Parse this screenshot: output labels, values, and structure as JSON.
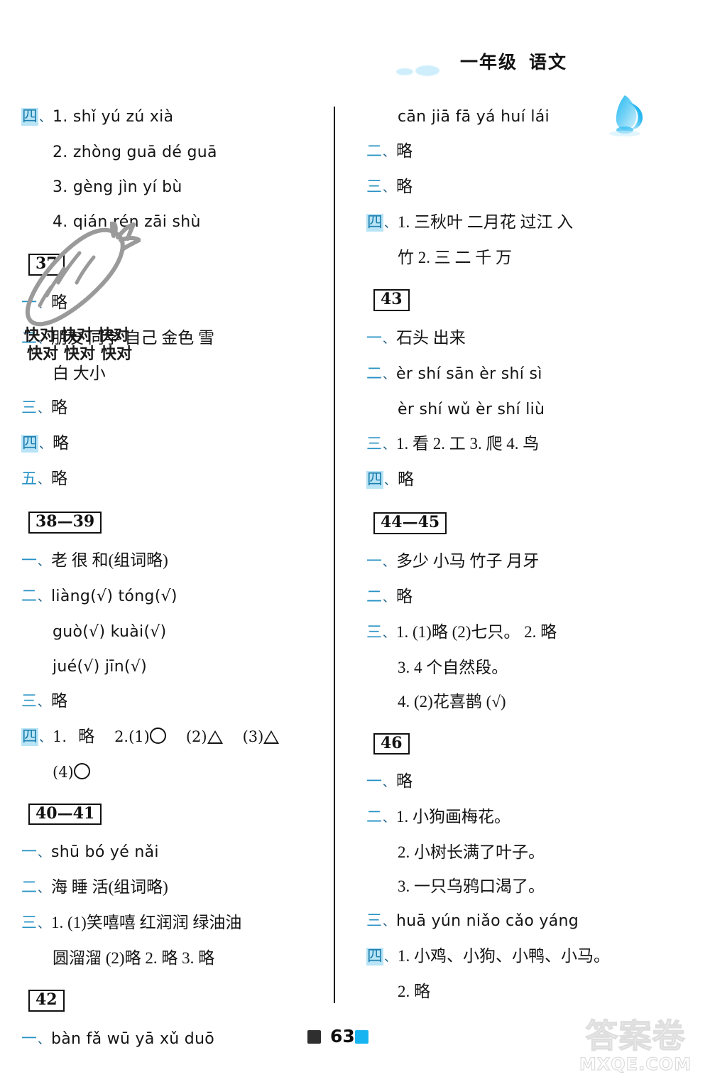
{
  "header": {
    "title_grade": "一年级",
    "title_subject": "语文",
    "cloud_icon": "cloud-icon",
    "bunny_icon": "blue-bunny-icon",
    "accent_color": "#16b4f0"
  },
  "footer": {
    "page_number": "63",
    "left_square_color": "#2f2f2f",
    "right_square_color": "#16b4f0"
  },
  "watermark": {
    "brand_cn": "答案卷",
    "site_url": "MXQE.COM",
    "overlay_text": "快对",
    "overlay_tiles": [
      "快对",
      "快对",
      "快对",
      "快对",
      "快对",
      "快对"
    ]
  },
  "decorations": {
    "carrot_icon": "carrot-outline-icon"
  },
  "left_column": {
    "continued_section": {
      "marker": "四",
      "dun": "、",
      "lines": [
        "1. shǐ   yú   zú   xià",
        "2. zhòng   guā   dé   guā",
        "3. gèng   jìn   yí   bù",
        "4. qián   rén   zāi   shù"
      ]
    },
    "sections": [
      {
        "box_label": "37",
        "items": [
          {
            "marker": "一",
            "dun": "、",
            "text": "略"
          },
          {
            "marker": "二",
            "dun": "、",
            "text": "朋友   同学   自己   金色   雪",
            "cont": "白   大小"
          },
          {
            "marker": "三",
            "dun": "、",
            "text": "略"
          },
          {
            "marker": "四",
            "dun": "、",
            "text": "略"
          },
          {
            "marker": "五",
            "dun": "、",
            "text": "略"
          }
        ]
      },
      {
        "box_label": "38—39",
        "items": [
          {
            "marker": "一",
            "dun": "、",
            "text": "老   很   和(组词略)"
          },
          {
            "marker": "二",
            "dun": "、",
            "text": "liàng(√)   tóng(√)",
            "cont1": "guò(√)   kuài(√)",
            "cont2": "jué(√)   jīn(√)"
          },
          {
            "marker": "三",
            "dun": "、",
            "text": "略"
          },
          {
            "marker": "四",
            "dun": "、",
            "text": "1. 略   2. (1)○   (2)△   (3)△",
            "cont": "(4)○"
          }
        ]
      },
      {
        "box_label": "40—41",
        "items": [
          {
            "marker": "一",
            "dun": "、",
            "text": "shū   bó   yé   nǎi"
          },
          {
            "marker": "二",
            "dun": "、",
            "text": "海   睡   活(组词略)"
          },
          {
            "marker": "三",
            "dun": "、",
            "text": "1. (1)笑嘻嘻   红润润   绿油油",
            "cont": "圆溜溜   (2)略   2. 略   3. 略"
          }
        ]
      },
      {
        "box_label": "42",
        "items": [
          {
            "marker": "一",
            "dun": "、",
            "text": "bàn fǎ   wū yā   xǔ duō"
          }
        ]
      }
    ]
  },
  "right_column": {
    "continued_section": {
      "line": "cān jiā   fā yá   huí lái",
      "items": [
        {
          "marker": "二",
          "dun": "、",
          "text": "略"
        },
        {
          "marker": "三",
          "dun": "、",
          "text": "略"
        },
        {
          "marker": "四",
          "dun": "、",
          "text": "1. 三秋叶   二月花   过江   入",
          "cont": "竹   2. 三   二   千   万"
        }
      ]
    },
    "sections": [
      {
        "box_label": "43",
        "items": [
          {
            "marker": "一",
            "dun": "、",
            "text": "石头   出来"
          },
          {
            "marker": "二",
            "dun": "、",
            "text": "èr shí   sān èr   shí sì",
            "cont": "èr shí   wǔ èr   shí liù"
          },
          {
            "marker": "三",
            "dun": "、",
            "text": "1. 看   2. 工   3. 爬   4. 鸟"
          },
          {
            "marker": "四",
            "dun": "、",
            "text": "略"
          }
        ]
      },
      {
        "box_label": "44—45",
        "items": [
          {
            "marker": "一",
            "dun": "、",
            "text": "多少   小马   竹子   月牙"
          },
          {
            "marker": "二",
            "dun": "、",
            "text": "略"
          },
          {
            "marker": "三",
            "dun": "、",
            "text": "1. (1)略   (2)七只。   2. 略",
            "cont1": "3. 4 个自然段。",
            "cont2": "4. (2)花喜鹊   (√)"
          }
        ]
      },
      {
        "box_label": "46",
        "items": [
          {
            "marker": "一",
            "dun": "、",
            "text": "略"
          },
          {
            "marker": "二",
            "dun": "、",
            "text": "1. 小狗画梅花。",
            "cont1": "2. 小树长满了叶子。",
            "cont2": "3. 一只乌鸦口渴了。"
          },
          {
            "marker": "三",
            "dun": "、",
            "text": "huā   yún   niǎo   cǎo   yáng"
          },
          {
            "marker": "四",
            "dun": "、",
            "text": "1. 小鸡、小狗、小鸭、小马。",
            "cont": "2. 略"
          }
        ]
      }
    ]
  }
}
